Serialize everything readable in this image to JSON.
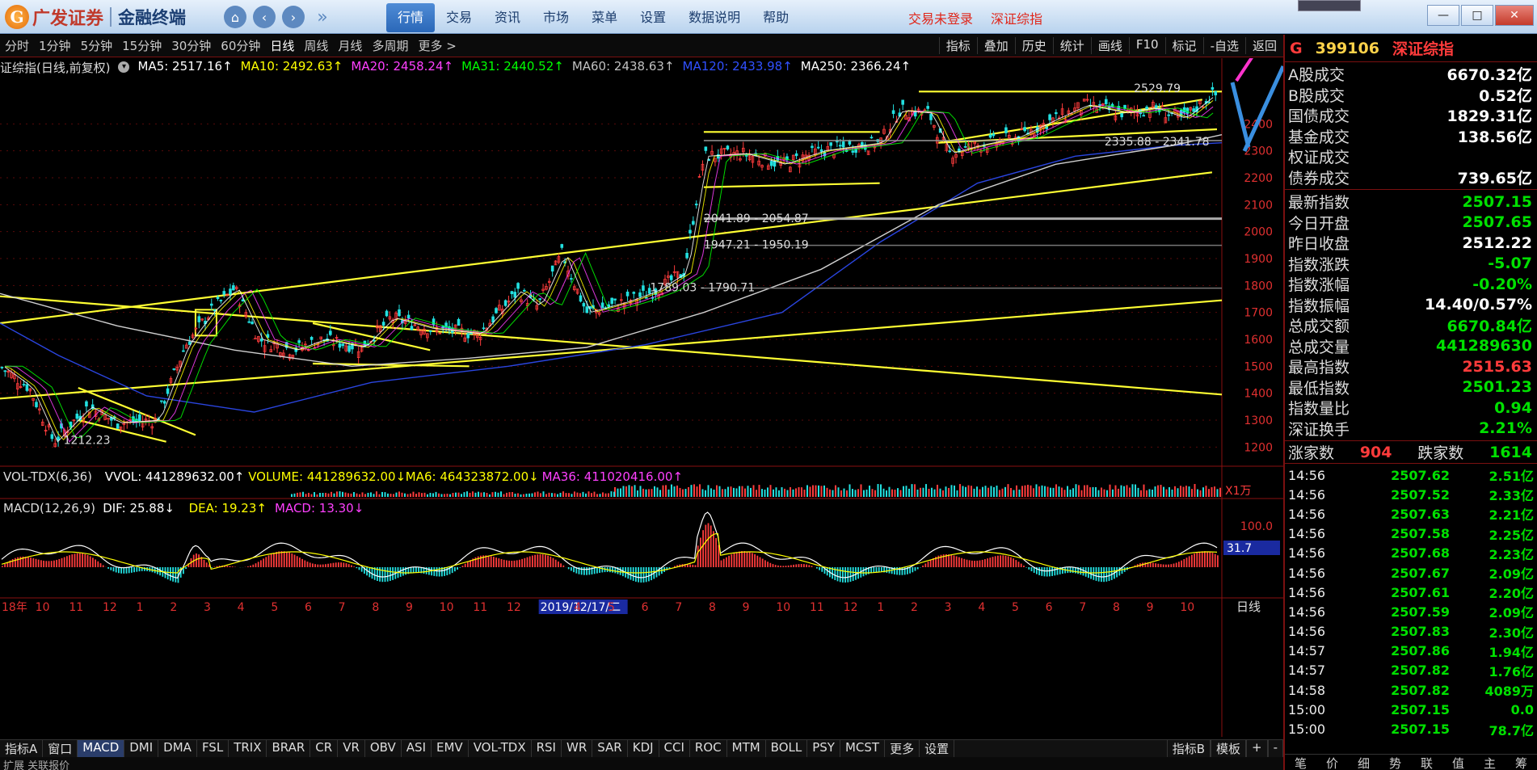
{
  "app": {
    "brand": "广发证券",
    "terminal": "金融终端",
    "logo_letter": "G"
  },
  "menu": [
    "行情",
    "交易",
    "资讯",
    "市场",
    "菜单",
    "设置",
    "数据说明",
    "帮助"
  ],
  "status": {
    "login": "交易未登录",
    "index": "深证综指"
  },
  "periods": [
    "分时",
    "1分钟",
    "5分钟",
    "15分钟",
    "30分钟",
    "60分钟",
    "日线",
    "周线",
    "月线",
    "多周期",
    "更多 >"
  ],
  "active_period": "日线",
  "tools": [
    "指标",
    "叠加",
    "历史",
    "统计",
    "画线",
    "F10",
    "标记",
    "-自选",
    "返回"
  ],
  "ma_legend": {
    "title": "证综指(日线,前复权)",
    "items": [
      {
        "label": "MA5: 2517.16↑",
        "color": "#ffffff"
      },
      {
        "label": "MA10: 2492.63↑",
        "color": "#ffff00"
      },
      {
        "label": "MA20: 2458.24↑",
        "color": "#ff40ff"
      },
      {
        "label": "MA31: 2440.52↑",
        "color": "#00ff00"
      },
      {
        "label": "MA60: 2438.63↑",
        "color": "#c0c0c0"
      },
      {
        "label": "MA120: 2433.98↑",
        "color": "#3050ff"
      },
      {
        "label": "MA250: 2366.24↑",
        "color": "#ffffff"
      }
    ]
  },
  "annotations": {
    "high": "2529.79",
    "low": "1212.23",
    "range1": "2335.88 - 2341.78",
    "range2": "2041.89 - 2054.87",
    "range3": "1947.21 - 1950.19",
    "range4": "1789.03 - 1790.71"
  },
  "volume_legend": [
    {
      "label": "VOL-TDX(6,36)",
      "color": "#dddddd"
    },
    {
      "label": "VVOL: 441289632.00↑",
      "color": "#ffffff"
    },
    {
      "label": "VOLUME: 441289632.00↓",
      "color": "#ffff00"
    },
    {
      "label": "MA6: 464323872.00↓",
      "color": "#ffff00"
    },
    {
      "label": "MA36: 411020416.00↑",
      "color": "#ff40ff"
    }
  ],
  "vol_unit": "X1万",
  "macd_legend": [
    {
      "label": "MACD(12,26,9)",
      "color": "#dddddd"
    },
    {
      "label": "DIF: 25.88↓",
      "color": "#ffffff"
    },
    {
      "label": "DEA: 19.23↑",
      "color": "#ffff00"
    },
    {
      "label": "MACD: 13.30↓",
      "color": "#ff40ff"
    }
  ],
  "macd_axis": {
    "top": "100.0",
    "cursor": "31.7"
  },
  "price_axis": [
    "2400",
    "2300",
    "2200",
    "2100",
    "2000",
    "1900",
    "1800",
    "1700",
    "1600",
    "1500",
    "1400",
    "1300",
    "1200"
  ],
  "date_axis": [
    "18年",
    "10",
    "11",
    "12",
    "1",
    "2",
    "3",
    "4",
    "5",
    "6",
    "7",
    "8",
    "9",
    "10",
    "11",
    "12",
    "2019/12/17/二",
    "4",
    "5",
    "6",
    "7",
    "8",
    "9",
    "10",
    "11",
    "12",
    "1",
    "2",
    "3",
    "4",
    "5",
    "6",
    "7",
    "8",
    "9",
    "10"
  ],
  "date_axis_mode": "日线",
  "indicator_tabs": [
    "指标A",
    "窗口",
    "MACD",
    "DMI",
    "DMA",
    "FSL",
    "TRIX",
    "BRAR",
    "CR",
    "VR",
    "OBV",
    "ASI",
    "EMV",
    "VOL-TDX",
    "RSI",
    "WR",
    "SAR",
    "KDJ",
    "CCI",
    "ROC",
    "MTM",
    "BOLL",
    "PSY",
    "MCST",
    "更多",
    "设置"
  ],
  "indicator_active": "MACD",
  "indicator_right": [
    "指标B",
    "模板",
    "+",
    "-"
  ],
  "bottom_strip": "扩展  关联报价",
  "quote": {
    "marker": "G",
    "code": "399106",
    "name": "深证综指",
    "turnover": [
      {
        "k": "A股成交",
        "v": "6670.32亿"
      },
      {
        "k": "B股成交",
        "v": "0.52亿"
      },
      {
        "k": "国债成交",
        "v": "1829.31亿"
      },
      {
        "k": "基金成交",
        "v": "138.56亿"
      },
      {
        "k": "权证成交",
        "v": ""
      },
      {
        "k": "债券成交",
        "v": "739.65亿"
      }
    ],
    "stats": [
      {
        "k": "最新指数",
        "v": "2507.15",
        "c": "g"
      },
      {
        "k": "今日开盘",
        "v": "2507.65",
        "c": "g"
      },
      {
        "k": "昨日收盘",
        "v": "2512.22",
        "c": "w"
      },
      {
        "k": "指数涨跌",
        "v": "-5.07",
        "c": "g"
      },
      {
        "k": "指数涨幅",
        "v": "-0.20%",
        "c": "g"
      },
      {
        "k": "指数振幅",
        "v": "14.40/0.57%",
        "c": "w"
      },
      {
        "k": "总成交额",
        "v": "6670.84亿",
        "c": "g"
      },
      {
        "k": "总成交量",
        "v": "441289630",
        "c": "g"
      },
      {
        "k": "最高指数",
        "v": "2515.63",
        "c": "r"
      },
      {
        "k": "最低指数",
        "v": "2501.23",
        "c": "g"
      },
      {
        "k": "指数量比",
        "v": "0.94",
        "c": "g"
      },
      {
        "k": "深证换手",
        "v": "2.21%",
        "c": "g"
      }
    ],
    "breadth": {
      "up_label": "涨家数",
      "up": "904",
      "down_label": "跌家数",
      "down": "1614"
    },
    "ticks": [
      {
        "t": "14:56",
        "p": "2507.62",
        "v": "2.51亿"
      },
      {
        "t": "14:56",
        "p": "2507.52",
        "v": "2.33亿"
      },
      {
        "t": "14:56",
        "p": "2507.63",
        "v": "2.21亿"
      },
      {
        "t": "14:56",
        "p": "2507.58",
        "v": "2.25亿"
      },
      {
        "t": "14:56",
        "p": "2507.68",
        "v": "2.23亿"
      },
      {
        "t": "14:56",
        "p": "2507.67",
        "v": "2.09亿"
      },
      {
        "t": "14:56",
        "p": "2507.61",
        "v": "2.20亿"
      },
      {
        "t": "14:56",
        "p": "2507.59",
        "v": "2.09亿"
      },
      {
        "t": "14:56",
        "p": "2507.83",
        "v": "2.30亿"
      },
      {
        "t": "14:57",
        "p": "2507.86",
        "v": "1.94亿"
      },
      {
        "t": "14:57",
        "p": "2507.82",
        "v": "1.76亿"
      },
      {
        "t": "14:58",
        "p": "2507.82",
        "v": "4089万"
      },
      {
        "t": "15:00",
        "p": "2507.15",
        "v": "0.0"
      },
      {
        "t": "15:00",
        "p": "2507.15",
        "v": "78.7亿"
      }
    ],
    "tabs": [
      "笔",
      "价",
      "细",
      "势",
      "联",
      "值",
      "主",
      "筹"
    ]
  },
  "chart_data": {
    "type": "line",
    "title": "证综指(日线,前复权)",
    "ylim": [
      1150,
      2560
    ],
    "y_ticks": [
      1200,
      1300,
      1400,
      1500,
      1600,
      1700,
      1800,
      1900,
      2000,
      2100,
      2200,
      2300,
      2400
    ],
    "series": [
      {
        "name": "MA120",
        "color": "#2a45e0",
        "points": [
          [
            0,
            1660
          ],
          [
            60,
            1540
          ],
          [
            150,
            1390
          ],
          [
            260,
            1330
          ],
          [
            380,
            1440
          ],
          [
            520,
            1500
          ],
          [
            660,
            1580
          ],
          [
            800,
            1700
          ],
          [
            900,
            1960
          ],
          [
            1000,
            2180
          ],
          [
            1100,
            2280
          ],
          [
            1200,
            2320
          ],
          [
            1250,
            2330
          ]
        ]
      },
      {
        "name": "MA250",
        "color": "#cfcfcf",
        "points": [
          [
            0,
            1770
          ],
          [
            120,
            1650
          ],
          [
            240,
            1560
          ],
          [
            360,
            1500
          ],
          [
            480,
            1530
          ],
          [
            600,
            1570
          ],
          [
            720,
            1700
          ],
          [
            840,
            1860
          ],
          [
            960,
            2100
          ],
          [
            1080,
            2250
          ],
          [
            1200,
            2320
          ],
          [
            1250,
            2360
          ]
        ]
      },
      {
        "name": "close",
        "color": "#ffffff",
        "points": [
          [
            0,
            1500
          ],
          [
            30,
            1420
          ],
          [
            55,
            1220
          ],
          [
            90,
            1350
          ],
          [
            120,
            1290
          ],
          [
            160,
            1300
          ],
          [
            190,
            1580
          ],
          [
            215,
            1700
          ],
          [
            240,
            1790
          ],
          [
            265,
            1600
          ],
          [
            300,
            1560
          ],
          [
            330,
            1600
          ],
          [
            370,
            1570
          ],
          [
            400,
            1680
          ],
          [
            440,
            1640
          ],
          [
            490,
            1620
          ],
          [
            530,
            1780
          ],
          [
            550,
            1720
          ],
          [
            575,
            1920
          ],
          [
            600,
            1700
          ],
          [
            640,
            1740
          ],
          [
            670,
            1780
          ],
          [
            700,
            1850
          ],
          [
            720,
            2280
          ],
          [
            760,
            2290
          ],
          [
            800,
            2250
          ],
          [
            840,
            2300
          ],
          [
            900,
            2330
          ],
          [
            920,
            2450
          ],
          [
            950,
            2440
          ],
          [
            970,
            2290
          ],
          [
            1000,
            2320
          ],
          [
            1040,
            2350
          ],
          [
            1080,
            2420
          ],
          [
            1110,
            2470
          ],
          [
            1150,
            2440
          ],
          [
            1180,
            2460
          ],
          [
            1210,
            2420
          ],
          [
            1240,
            2507
          ]
        ]
      }
    ],
    "volume_series": "VOL-TDX",
    "macd_series": "MACD(12,26,9)"
  }
}
